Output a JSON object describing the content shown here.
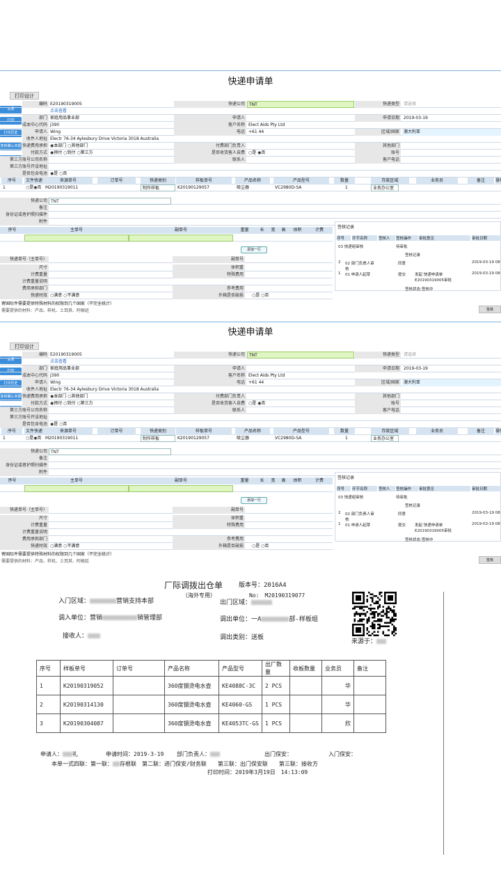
{
  "form": {
    "title": "快递申请单",
    "print_design": "打印设计",
    "side_buttons": [
      "关闭",
      "打印",
      "打印历史",
      "复核确认单据",
      "<<"
    ],
    "fields": {
      "code_label": "编码",
      "code": "E20190319005",
      "click_view": "点击查看",
      "dept_label": "部门",
      "dept": "家庭用品事业部",
      "cost_label": "成本中心代码",
      "cost": "J390",
      "applicant_label": "申请人",
      "applicant": "Wing",
      "courier_label": "快递公司",
      "courier": "TNT",
      "courier_type_label": "快递类型",
      "courier_type_ph": "请选择",
      "req_label": "申请人",
      "req_date_label": "申请日期",
      "req_date": "2019-03-19",
      "cust_label": "客户名称",
      "cust": "Elect Aids Pty Ltd",
      "phone_label": "电话",
      "phone": "+61 44",
      "region_label": "区域/国家",
      "region": "澳大利亚",
      "addr_label": "收件人地址",
      "addr": "Electr 76-34 Aylesbury Drive Victoria 3018 Australia",
      "mail_label": "快递费用承担",
      "opt_dept": "本部门",
      "opt_other": "其他部门",
      "pay_label": "付款方式",
      "opt_prepaid": "预付",
      "opt_collect": "到付",
      "opt_third": "第三方",
      "pay_owner_label": "付费部门负责人",
      "other_dept_label": "其他部门",
      "acct_label": "第三方账号公司名称",
      "is_owner_label": "是否收货客人自费",
      "yes": "是",
      "no": "否",
      "account_label": "账号",
      "contact_label": "联系人",
      "cust_phone_label": "客户电话",
      "third_label": "第三方账号开设地址",
      "battery_label": "是否包含电池"
    },
    "items_header": [
      "序号",
      "文件快递",
      "来源单号",
      "订单号",
      "快递类别",
      "样板单号",
      "产品名称",
      "产品型号",
      "数量",
      "存款区域",
      "业务员",
      "备注",
      "操作"
    ],
    "items_row": {
      "no": "1",
      "yes": "是",
      "no_opt": "否",
      "src": "M20190319011",
      "cat": "制作样板",
      "sample": "K20190129057",
      "prod": "吸尘器",
      "model": "VC2980D-SA",
      "qty": "1",
      "area": "业务办公室"
    },
    "courier2_label": "快递公司",
    "courier2": "TNT",
    "remark_label": "备注",
    "id_label": "身份证或者护照扫描件",
    "attach_label": "附件",
    "pkg_header": [
      "序号",
      "主单号",
      "副单号",
      "重量",
      "长",
      "宽",
      "高",
      "体积",
      "计费"
    ],
    "add_row": "添加一行",
    "bottom": {
      "main_no_label": "快递单号（主单号）",
      "sub_no_label": "副单号",
      "size_label": "尺寸",
      "vol_label": "体积重",
      "bill_w_label": "计费重量",
      "special_label": "特殊费用",
      "bill_desc_label": "计费重量说明",
      "payer_label": "费用承担部门",
      "ref_label": "参考费用",
      "eff_label": "快递时效",
      "opt_sat": "满意",
      "opt_unsat": "不满意",
      "out_label": "外箱是否破损",
      "note1": "寄国际件需要提供特殊材料的权限到几个国家（不完全统计）",
      "note2": "需要提供的材料：产品、样机、土耳其、阿根廷"
    },
    "review": {
      "title": "签核记录",
      "header": [
        "序号",
        "环节名称",
        "签核人",
        "签核操作",
        "审批意见",
        "审批日期"
      ],
      "pending": {
        "step": "03 快递组审核",
        "op": "待审批"
      },
      "record_title": "签核记录",
      "rows": [
        {
          "no": "2",
          "step": "02 部门负责人审核",
          "op": "同意",
          "opinion": "",
          "date": "2019-03-19 08"
        },
        {
          "no": "1",
          "step": "01 申请人起草",
          "op": "提交",
          "opinion": "发起 快递申请单 E20190319005审批",
          "date": "2019-03-19 08"
        }
      ],
      "status": "签核状态:签核中",
      "check_btn": "签核"
    }
  },
  "slip": {
    "title": "厂际调拨出仓单",
    "edition": "版本号：2016A4",
    "subtitle": "（海外专用）",
    "no_label": "No:",
    "no": "M20190319077",
    "in_area": "入门区域：",
    "in_area_v": "营销支持本部",
    "out_area": "出门区域：",
    "in_unit": "调入单位：营销",
    "in_unit_v": "销管理部",
    "out_unit": "调出单位：一A",
    "out_unit_v": "部-样板组",
    "receiver": "接收人：",
    "out_type": "调出类别：",
    "out_type_v": "送板",
    "from": "来源于：",
    "header": [
      "序号",
      "样板单号",
      "订单号",
      "产品名称",
      "产品型号",
      "出厂数量",
      "收板数量",
      "业务员",
      "备注"
    ],
    "rows": [
      {
        "no": "1",
        "sample": "K20190319052",
        "order": "",
        "name": "360度钢烫电水壶",
        "model": "KE4088C-3C",
        "qty": "2 PCS",
        "recv": "",
        "sales": "华",
        "note": ""
      },
      {
        "no": "2",
        "sample": "K20190314130",
        "order": "",
        "name": "360度钢烫电水壶",
        "model": "KE4060-GS",
        "qty": "1 PCS",
        "recv": "",
        "sales": "华",
        "note": ""
      },
      {
        "no": "3",
        "sample": "K20190304087",
        "order": "",
        "name": "360度钢烫电水壶",
        "model": "KE4053TC-GS",
        "qty": "1 PCS",
        "recv": "",
        "sales": "欣",
        "note": ""
      }
    ],
    "applicant": "申请人：",
    "applicant_v": "礼",
    "apply_time": "申请时间：2019-3-19",
    "dept_head": "部门负责人：",
    "out_guard": "出门保安：",
    "in_guard": "入门保安：",
    "copies": "本单一式四联：第一联：",
    "copies2": "存根联",
    "copies3": "第二联：进门保安/财务联　　第三联：出门保安联　　第三联：接收方",
    "print_time": "打印时间：2019年3月19日　14:13:09"
  }
}
